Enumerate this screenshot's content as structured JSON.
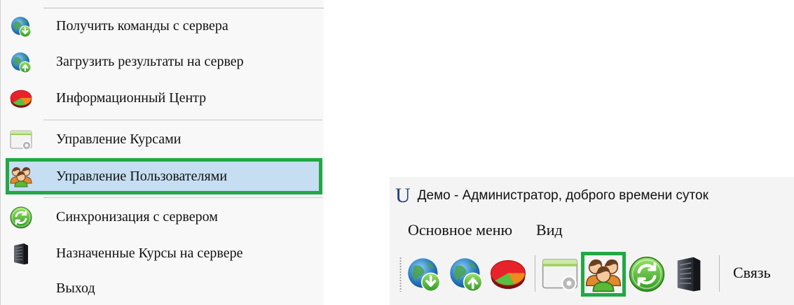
{
  "menu": {
    "items": [
      {
        "label": "Получить команды с сервера",
        "icon": "globe-download-icon"
      },
      {
        "label": "Загрузить результаты на сервер",
        "icon": "globe-upload-icon"
      },
      {
        "label": "Информационный Центр",
        "icon": "pie-chart-icon"
      },
      {
        "label": "Управление Курсами",
        "icon": "window-settings-icon"
      },
      {
        "label": "Управление Пользователями",
        "icon": "users-icon",
        "highlighted": true
      },
      {
        "label": "Синхронизация с сервером",
        "icon": "sync-icon"
      },
      {
        "label": "Назначенные Курсы на сервере",
        "icon": "server-icon"
      },
      {
        "label": "Выход",
        "icon": ""
      }
    ]
  },
  "window": {
    "logo": "U",
    "title": "Демо - Администратор, доброго времени суток",
    "menubar": [
      "Основное меню",
      "Вид"
    ],
    "toolbar_link": "Связь"
  },
  "colors": {
    "highlight_fill": "#c5def2",
    "highlight_border": "#22a844",
    "logo": "#1e3f8a"
  }
}
